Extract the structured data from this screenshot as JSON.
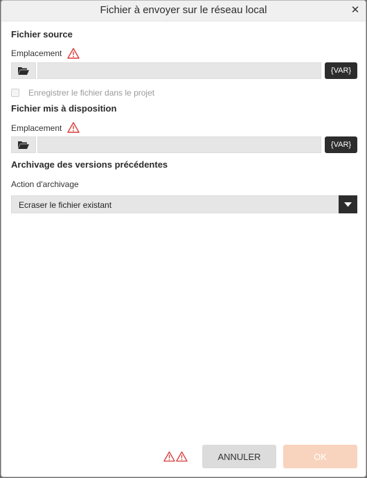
{
  "window": {
    "title": "Fichier à envoyer sur le réseau local",
    "close_glyph": "✕"
  },
  "source": {
    "heading": "Fichier source",
    "location_label": "Emplacement",
    "path_value": "",
    "var_label": "{VAR}",
    "checkbox_label": "Enregistrer le fichier dans le projet"
  },
  "destination": {
    "heading": "Fichier mis à disposition",
    "location_label": "Emplacement",
    "path_value": "",
    "var_label": "{VAR}"
  },
  "archive": {
    "heading": "Archivage des versions précédentes",
    "action_label": "Action d'archivage",
    "selected_action": "Ecraser le fichier existant"
  },
  "footer": {
    "cancel_label": "ANNULER",
    "ok_label": "OK"
  },
  "colors": {
    "accent_disabled": "#f8d3bd",
    "warning": "#d93a3a",
    "dark": "#2d2d2d"
  },
  "icons": {
    "warning": "warning-triangle-icon",
    "folder": "folder-open-icon",
    "dropdown": "chevron-down-icon"
  }
}
